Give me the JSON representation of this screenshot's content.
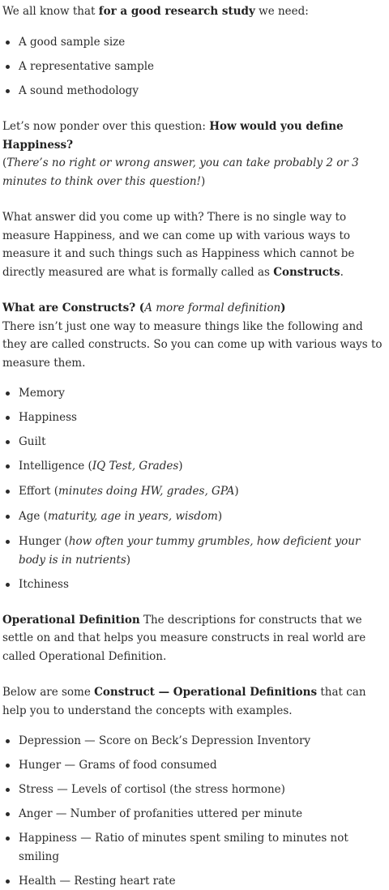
{
  "intro": {
    "pre": "We all know that ",
    "bold": "for a good research study",
    "post": " we need:"
  },
  "requirements": [
    "A good sample size",
    "A representative sample",
    "A sound methodology"
  ],
  "question": {
    "pre": "Let’s now ponder over this question: ",
    "bold": "How would you define Happiness?",
    "open_paren": "(",
    "italic": "There’s no right or wrong answer, you can take probably 2 or 3 minutes to think over this question!",
    "close_paren": ")"
  },
  "answer": {
    "text": "What answer did you come up with? There is no single way to measure Happiness, and we can come up with various ways to measure it and such things such as Happiness which cannot be directly measured are what is formally called as ",
    "bold": "Constructs",
    "post": "."
  },
  "constructs": {
    "heading_bold": "What are Constructs? (",
    "heading_italic": "A more formal definition",
    "heading_close": ")",
    "body": "There isn’t just one way to measure things like the following and they are called constructs. So you can come up with various ways to measure them."
  },
  "construct_list": [
    {
      "label": "Memory",
      "detail": ""
    },
    {
      "label": "Happiness",
      "detail": ""
    },
    {
      "label": "Guilt",
      "detail": ""
    },
    {
      "label": "Intelligence (",
      "detail": "IQ Test, Grades",
      "close": ")"
    },
    {
      "label": "Effort (",
      "detail": "minutes doing HW, grades, GPA",
      "close": ")"
    },
    {
      "label": "Age (",
      "detail": "maturity, age in years, wisdom",
      "close": ")"
    },
    {
      "label": "Hunger (",
      "detail": "how often your tummy grumbles, how deficient your body is in nutrients",
      "close": ")"
    },
    {
      "label": "Itchiness",
      "detail": ""
    }
  ],
  "operational": {
    "bold": "Operational Definition",
    "text": " The descriptions for constructs that we settle on and that helps you measure constructs in real world are called Operational Definition."
  },
  "examples_intro": {
    "pre": "Below are some ",
    "bold": "Construct — Operational Definitions",
    "post": " that can help you to understand the concepts with examples."
  },
  "examples": [
    "Depression — Score on Beck’s Depression Inventory",
    "Hunger — Grams of food consumed",
    "Stress — Levels of cortisol (the stress hormone)",
    "Anger — Number of profanities uttered per minute",
    "Happiness — Ratio of minutes spent smiling to minutes not smiling",
    "Health — Resting heart rate"
  ]
}
